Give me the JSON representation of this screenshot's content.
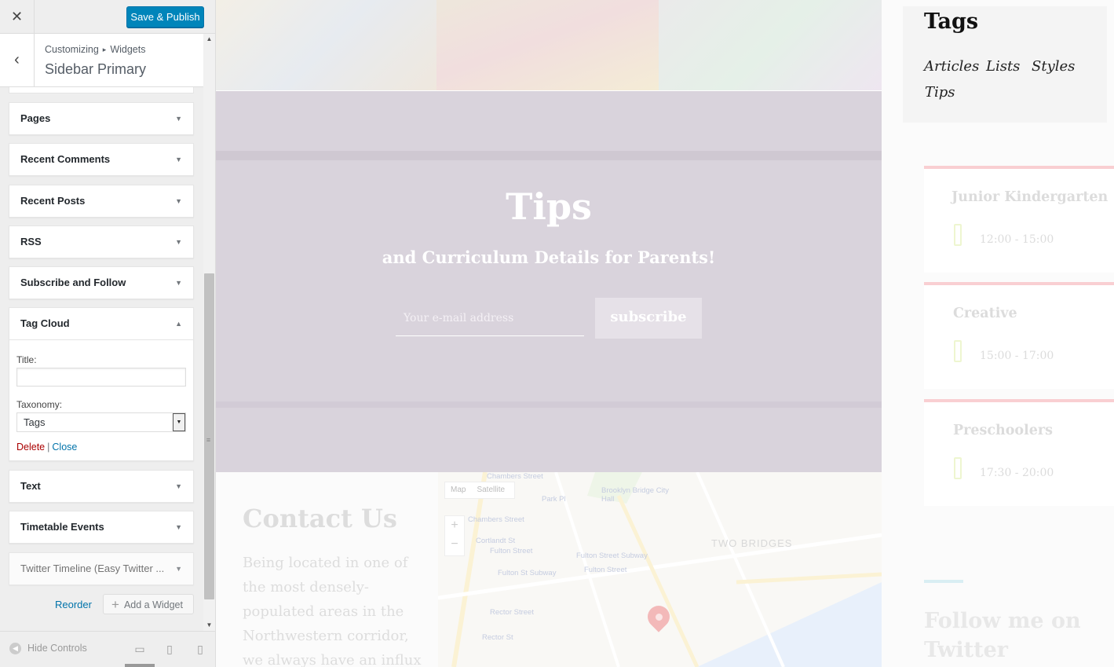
{
  "panel": {
    "close_icon": "close-icon",
    "save_label": "Save & Publish",
    "back_icon": "back-arrow-icon",
    "breadcrumb": [
      "Customizing",
      "Widgets"
    ],
    "breadcrumb_sep": "▸",
    "section_title": "Sidebar Primary",
    "widgets_top": [
      {
        "label": "Pages"
      },
      {
        "label": "Recent Comments"
      },
      {
        "label": "Recent Posts"
      },
      {
        "label": "RSS"
      },
      {
        "label": "Subscribe and Follow"
      }
    ],
    "tag_cloud": {
      "label": "Tag Cloud",
      "title_label": "Title:",
      "title_value": "",
      "taxonomy_label": "Taxonomy:",
      "taxonomy_value": "Tags",
      "delete_label": "Delete",
      "separator": "|",
      "close_label": "Close"
    },
    "widgets_bottom": [
      {
        "label": "Text"
      },
      {
        "label": "Timetable Events"
      },
      {
        "label": "Twitter Timeline (Easy Twitter ..."
      }
    ],
    "reorder_label": "Reorder",
    "add_widget_label": "Add a Widget",
    "hide_controls_label": "Hide Controls",
    "devices": [
      "desktop",
      "tablet",
      "mobile"
    ]
  },
  "preview": {
    "hero_title": "Tips",
    "hero_subtitle": "and Curriculum Details for Parents!",
    "email_placeholder": "Your e-mail address",
    "subscribe_label": "subscribe",
    "contact_title": "Contact Us",
    "contact_text": "Being located in one of the most densely-populated areas in the Northwestern corridor, we always have an influx of new kids every",
    "map": {
      "type_map": "Map",
      "type_satellite": "Satellite",
      "zoom_in": "+",
      "zoom_out": "−",
      "labels": [
        "Chambers Street",
        "Park Pl",
        "Brooklyn Bridge City Hall",
        "Chambers Street",
        "Cortlandt St",
        "Fulton Street",
        "Fulton Street Subway",
        "Fulton Street",
        "Fulton St Subway",
        "Rector Street",
        "Rector St"
      ],
      "big_label": "TWO BRIDGES"
    },
    "tags_title": "Tags",
    "tags": [
      "Articles",
      "Lists",
      "Styles",
      "Tips"
    ],
    "events": [
      {
        "name": "Junior Kindergarten",
        "time": "12:00 - 15:00"
      },
      {
        "name": "Creative",
        "time": "15:00 - 17:00"
      },
      {
        "name": "Preschoolers",
        "time": "17:30 - 20:00"
      }
    ],
    "follow_title": "Follow me on Twitter"
  }
}
